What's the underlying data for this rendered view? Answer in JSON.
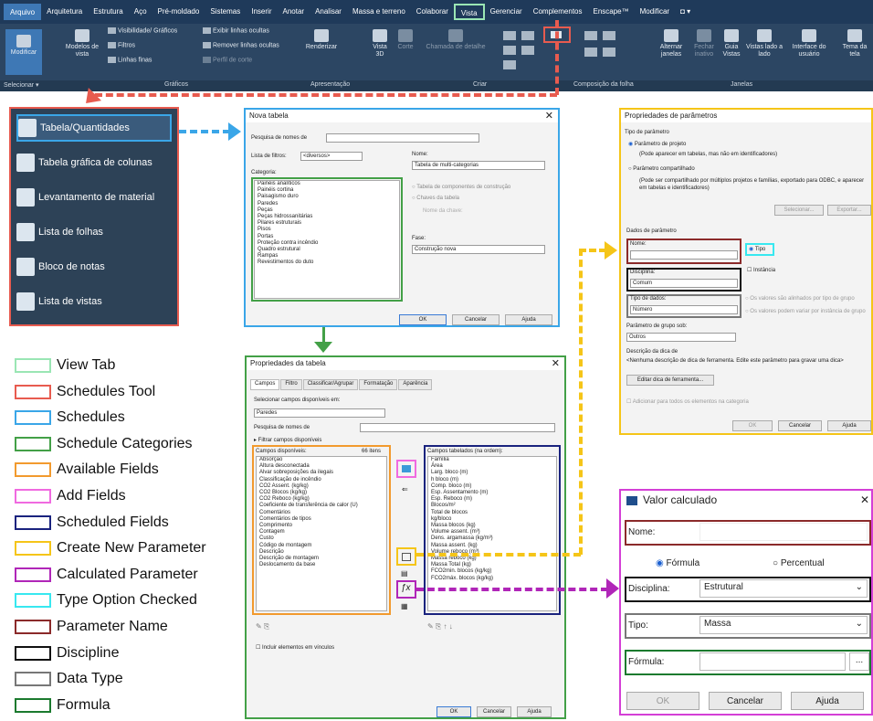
{
  "menu": {
    "tabs": [
      "Arquivo",
      "Arquitetura",
      "Estrutura",
      "Aço",
      "Pré-moldado",
      "Sistemas",
      "Inserir",
      "Anotar",
      "Analisar",
      "Massa e terreno",
      "Colaborar",
      "Vista",
      "Gerenciar",
      "Complementos",
      "Enscape™",
      "Modificar",
      "◘ ▾"
    ]
  },
  "ribbon": {
    "modificar": "Modificar",
    "modelos": "Modelos de vista",
    "visibilidade": "Visibilidade/ Gráficos",
    "filtros": "Filtros",
    "linhas_finas": "Linhas finas",
    "exibir_linhas": "Exibir linhas ocultas",
    "remover_linhas": "Remover linhas ocultas",
    "perfil_corte": "Perfil de corte",
    "renderizar": "Renderizar",
    "vista3d": "Vista 3D",
    "corte": "Corte",
    "chamada": "Chamada de detalhe",
    "alternar": "Alternar janelas",
    "fechar": "Fechar inativo",
    "guia": "Guia Vistas",
    "lado": "Vistas lado a lado",
    "interface": "Interface do usuário",
    "tema": "Tema da tela"
  },
  "groups": [
    "Selecionar ▾",
    "Gráficos",
    "Apresentação",
    "Criar",
    "Composição da folha",
    "Janelas"
  ],
  "tools": [
    "Tabela/Quantidades",
    "Tabela gráfica de colunas",
    "Levantamento de material",
    "Lista de folhas",
    "Bloco de notas",
    "Lista de vistas"
  ],
  "nova_tabela": {
    "title": "Nova tabela",
    "close": "✕",
    "search_label": "Pesquisa de nomes de",
    "filter_label": "Lista de filtros:",
    "filter_value": "<diversos>",
    "category_label": "Categoria:",
    "categories": [
      "Painéis analíticos",
      "Painéis cortina",
      "Paisagismo duro",
      "Paredes",
      "Peças",
      "Peças hidrossanitárias",
      "Pilares estruturais",
      "Pisos",
      "Portas",
      "Proteção contra incêndio",
      "Quadro estrutural",
      "Rampas",
      "Revestimentos do duto"
    ],
    "name_label": "Nome:",
    "name_value": "Tabela de multi-categorias",
    "radio1": "Tabela de componentes de construção",
    "radio2": "Chaves da tabela",
    "key_name": "Nome da chave:",
    "phase_label": "Fase:",
    "phase_value": "Construção nova",
    "ok": "OK",
    "cancel": "Cancelar",
    "help": "Ajuda"
  },
  "prop_tabela": {
    "title": "Propriedades da tabela",
    "close": "✕",
    "tabs": [
      "Campos",
      "Filtro",
      "Classificar/Agrupar",
      "Formatação",
      "Aparência"
    ],
    "select_label": "Selecionar campos disponíveis em:",
    "select_value": "Paredes",
    "search_label": "Pesquisa de nomes de",
    "filter_fields": "▸ Filtrar campos disponíveis",
    "avail_title": "Campos disponíveis:",
    "avail_count": "66 itens",
    "available": [
      "Absorção",
      "Altura desconectada",
      "Alvar sobreposições da ilegais",
      "Classificação de incêndio",
      "CO2 Assent. (kg/kg)",
      "CO2 Blocos (kg/kg)",
      "CO2 Reboco (kg/kg)",
      "Coeficiente de transferência de calor (U)",
      "Comentários",
      "Comentários de tipos",
      "Comprimento",
      "Contagem",
      "Custo",
      "Código de montagem",
      "Descrição",
      "Descrição de montagem",
      "Deslocamento da base"
    ],
    "sched_title": "Campos tabelados (na ordem):",
    "scheduled": [
      "Família",
      "Área",
      "Larg. bloco (m)",
      "h bloco (m)",
      "Comp. bloco (m)",
      "Esp. Assentamento (m)",
      "Esp. Reboco (m)",
      "Blocos/m²",
      "Total de blocos",
      "kg/bloco",
      "Massa blocos (kg)",
      "Volume assent. (m³)",
      "Dens. argamassa (kg/m³)",
      "Massa assent. (kg)",
      "Volume reboco (m³)",
      "Massa reboco (kg)",
      "Massa Total (kg)",
      "FCO2min. blocos (kg/kg)",
      "FCO2máx. blocos (kg/kg)"
    ],
    "include_links": "Incluir elementos em vínculos",
    "ok": "OK",
    "cancel": "Cancelar",
    "help": "Ajuda"
  },
  "prop_param": {
    "title": "Propriedades de parâmetros",
    "type_label": "Tipo de parâmetro",
    "project_param": "Parâmetro de projeto",
    "project_desc": "(Pode aparecer em tabelas, mas não em identificadores)",
    "shared_param": "Parâmetro compartilhado",
    "shared_desc": "(Pode ser compartilhado por múltiplos projetos e famílias, exportado para ODBC, e aparecer em tabelas e identificadores)",
    "select": "Selecionar...",
    "export": "Exportar...",
    "data_label": "Dados de parâmetro",
    "name_label": "Nome:",
    "type_opt": "Tipo",
    "instance_opt": "Instância",
    "discipline_label": "Disciplina:",
    "discipline_value": "Comum",
    "datatype_label": "Tipo de dados:",
    "datatype_value": "Número",
    "vary1": "Os valores são alinhados por tipo de grupo",
    "vary2": "Os valores podem variar por instância de grupo",
    "group_label": "Parâmetro de grupo sob:",
    "group_value": "Outros",
    "tooltip_label": "Descrição da dica de",
    "tooltip_value": "<Nenhuma descrição de dica de ferramenta. Edite este parâmetro para gravar uma dica>",
    "edit_tooltip": "Editar dica de ferramenta...",
    "add_all": "Adicionar para todos os elementos na categoria",
    "ok": "OK",
    "cancel": "Cancelar",
    "help": "Ajuda"
  },
  "valor_calc": {
    "title": "Valor calculado",
    "close": "✕",
    "name_label": "Nome:",
    "formula_opt": "Fórmula",
    "percent_opt": "Percentual",
    "discipline_label": "Disciplina:",
    "discipline_value": "Estrutural",
    "type_label": "Tipo:",
    "type_value": "Massa",
    "formula_label": "Fórmula:",
    "dots": "...",
    "ok": "OK",
    "cancel": "Cancelar",
    "help": "Ajuda"
  },
  "legend": [
    {
      "label": "View Tab",
      "color": "#9ae6b4"
    },
    {
      "label": "Schedules Tool",
      "color": "#e85b4f"
    },
    {
      "label": "Schedules",
      "color": "#3aa6e8"
    },
    {
      "label": "Schedule Categories",
      "color": "#43a047"
    },
    {
      "label": "Available Fields",
      "color": "#f29a2e"
    },
    {
      "label": "Add Fields",
      "color": "#f06ae0"
    },
    {
      "label": "Scheduled Fields",
      "color": "#1a237e"
    },
    {
      "label": "Create New Parameter",
      "color": "#f5c518"
    },
    {
      "label": "Calculated Parameter",
      "color": "#b026b8"
    },
    {
      "label": "Type Option Checked",
      "color": "#38e8f0"
    },
    {
      "label": "Parameter Name",
      "color": "#8b2a2a"
    },
    {
      "label": "Discipline",
      "color": "#111111"
    },
    {
      "label": "Data Type",
      "color": "#777777"
    },
    {
      "label": "Formula",
      "color": "#1b7a2e"
    }
  ]
}
